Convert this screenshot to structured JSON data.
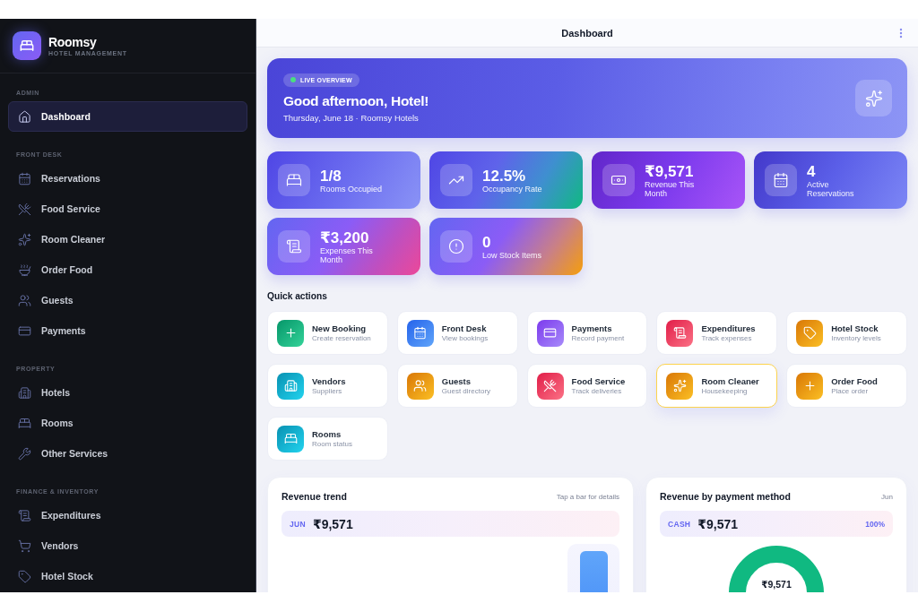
{
  "sidebar": {
    "brand": {
      "name": "Roomsy",
      "tagline": "HOTEL MANAGEMENT"
    },
    "sections": [
      {
        "title": "ADMIN",
        "items": [
          {
            "label": "Dashboard",
            "selected": true
          }
        ]
      },
      {
        "title": "FRONT DESK",
        "items": [
          {
            "label": "Reservations",
            "selected": false
          },
          {
            "label": "Food Service",
            "selected": false
          },
          {
            "label": "Room Cleaner",
            "selected": false
          },
          {
            "label": "Order Food",
            "selected": false
          },
          {
            "label": "Guests",
            "selected": false
          },
          {
            "label": "Payments",
            "selected": false
          }
        ]
      },
      {
        "title": "PROPERTY",
        "items": [
          {
            "label": "Hotels",
            "selected": false
          },
          {
            "label": "Rooms",
            "selected": false
          },
          {
            "label": "Other Services",
            "selected": false
          }
        ]
      },
      {
        "title": "FINANCE & INVENTORY",
        "items": [
          {
            "label": "Expenditures",
            "selected": false
          },
          {
            "label": "Vendors",
            "selected": false
          },
          {
            "label": "Hotel Stock",
            "selected": false
          }
        ]
      }
    ]
  },
  "header": {
    "title": "Dashboard"
  },
  "hero": {
    "badge": "LIVE OVERVIEW",
    "title": "Good afternoon, Hotel!",
    "subtitle": "Thursday, June 18 · Roomsy Hotels"
  },
  "stats": [
    {
      "value": "1/8",
      "label": "Rooms Occupied"
    },
    {
      "value": "12.5%",
      "label": "Occupancy Rate"
    },
    {
      "value": "₹9,571",
      "label": "Revenue This Month"
    },
    {
      "value": "4",
      "label": "Active Reservations"
    },
    {
      "value": "₹3,200",
      "label": "Expenses This Month"
    },
    {
      "value": "0",
      "label": "Low Stock Items"
    }
  ],
  "quick_actions": {
    "title": "Quick actions",
    "items": [
      {
        "title": "New Booking",
        "subtitle": "Create reservation",
        "selected": false
      },
      {
        "title": "Front Desk",
        "subtitle": "View bookings",
        "selected": false
      },
      {
        "title": "Payments",
        "subtitle": "Record payment",
        "selected": false
      },
      {
        "title": "Expenditures",
        "subtitle": "Track expenses",
        "selected": false
      },
      {
        "title": "Hotel Stock",
        "subtitle": "Inventory levels",
        "selected": false
      },
      {
        "title": "Vendors",
        "subtitle": "Suppliers",
        "selected": false
      },
      {
        "title": "Guests",
        "subtitle": "Guest directory",
        "selected": false
      },
      {
        "title": "Food Service",
        "subtitle": "Track deliveries",
        "selected": false
      },
      {
        "title": "Room Cleaner",
        "subtitle": "Housekeeping",
        "selected": true
      },
      {
        "title": "Order Food",
        "subtitle": "Place order",
        "selected": false
      },
      {
        "title": "Rooms",
        "subtitle": "Room status",
        "selected": false
      }
    ]
  },
  "revenue_trend": {
    "title": "Revenue trend",
    "hint": "Tap a bar for details",
    "summary": {
      "label": "JUN",
      "value": "₹9,571"
    }
  },
  "payment_methods": {
    "title": "Revenue by payment method",
    "period": "Jun",
    "summary": {
      "label": "CASH",
      "value": "₹9,571",
      "share": "100%"
    },
    "center_label": "₹9,571"
  }
}
